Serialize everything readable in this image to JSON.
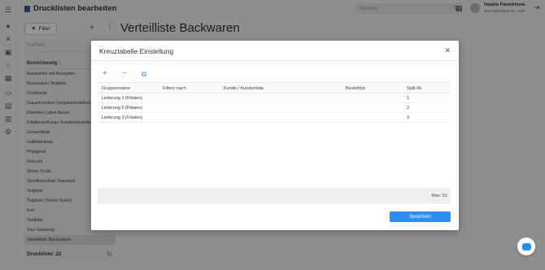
{
  "app": {
    "title": "Drucklisten bearbeiten"
  },
  "header": {
    "search_placeholder": "Suchen",
    "user_name": "Natalia Pastukhova",
    "user_sub": "Test Datenbank Ms. Sorh"
  },
  "toolbar": {
    "filter_label": "Filter"
  },
  "page": {
    "title": "Verteilliste Backwaren"
  },
  "list": {
    "search_placeholder": "Suchen",
    "header": "Bezeichnung",
    "items": [
      "Backzettel mit Rezepten",
      "Backwaren Teigliste",
      "Confiserie",
      "Dauerkunden/ Vorgabebestellungen",
      "Etiketten Label Assist",
      "Filialbestellung+ Kundenbestellung",
      "Gesamtliste",
      "Halbfabrikate",
      "Pfazgerei",
      "Retoure",
      "Smart Scale",
      "Speditionsliste Standard",
      "Teigliste",
      "Teigliste (Smart Scale)",
      "test",
      "Testliste",
      "Tour Samstag",
      "Verteilliste Backwaren"
    ],
    "footer": "Druckliste: 22"
  },
  "dialog": {
    "title": "Kreuztabelle Einstellung",
    "columns": [
      "Gruppenname",
      "Filtern nach",
      "Kunde / Kundenliste",
      "Bestelltyp",
      "Split-Nr."
    ],
    "rows": [
      [
        "Lieferung 1 (Filialen)",
        "",
        "",
        "",
        "1"
      ],
      [
        "Lieferung 2 (Filialen)",
        "",
        "",
        "",
        "2"
      ],
      [
        "Lieferung 3 (Filialen)",
        "",
        "",
        "",
        "3"
      ]
    ],
    "footer_max": "Max: 51",
    "save_label": "Speichern"
  },
  "colors": {
    "accent": "#2b8ef0",
    "brand": "#2c5aa0"
  }
}
